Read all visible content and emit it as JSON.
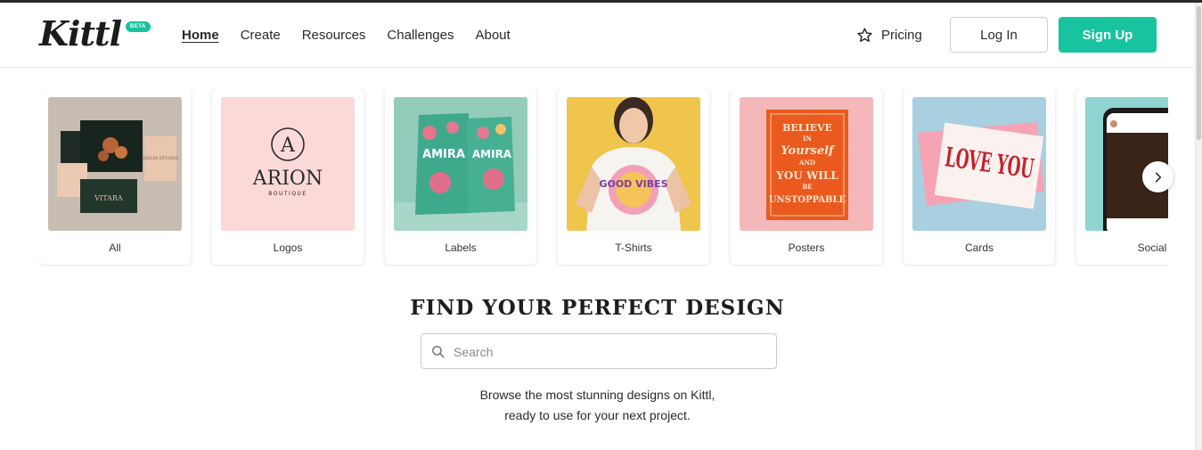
{
  "brand": {
    "name": "Kittl",
    "badge": "BETA",
    "accent": "#18c39f"
  },
  "nav": {
    "items": [
      {
        "label": "Home",
        "active": true
      },
      {
        "label": "Create",
        "active": false
      },
      {
        "label": "Resources",
        "active": false
      },
      {
        "label": "Challenges",
        "active": false
      },
      {
        "label": "About",
        "active": false
      }
    ]
  },
  "header": {
    "pricing_label": "Pricing",
    "pricing_icon": "star-icon",
    "login_label": "Log In",
    "signup_label": "Sign Up"
  },
  "categories": [
    {
      "label": "All",
      "art": {
        "logo": "ARION"
      }
    },
    {
      "label": "Logos",
      "art": {
        "monogram": "A",
        "title": "ARION",
        "subtitle": "BOUTIQUE"
      }
    },
    {
      "label": "Labels",
      "art": {
        "text": "AMIRA"
      }
    },
    {
      "label": "T-Shirts",
      "art": {
        "text": "GOOD VIBES"
      }
    },
    {
      "label": "Posters",
      "art": {
        "lines": [
          "BELIEVE",
          "IN",
          "Yourself",
          "AND",
          "YOU WILL",
          "BE",
          "UNSTOPPABLE"
        ]
      }
    },
    {
      "label": "Cards",
      "art": {
        "text": "LOVE YOU"
      }
    },
    {
      "label": "Social"
    }
  ],
  "search": {
    "title": "FIND YOUR PERFECT DESIGN",
    "placeholder": "Search",
    "subtext_line1": "Browse the most stunning designs on Kittl,",
    "subtext_line2": "ready to use for your next project."
  }
}
